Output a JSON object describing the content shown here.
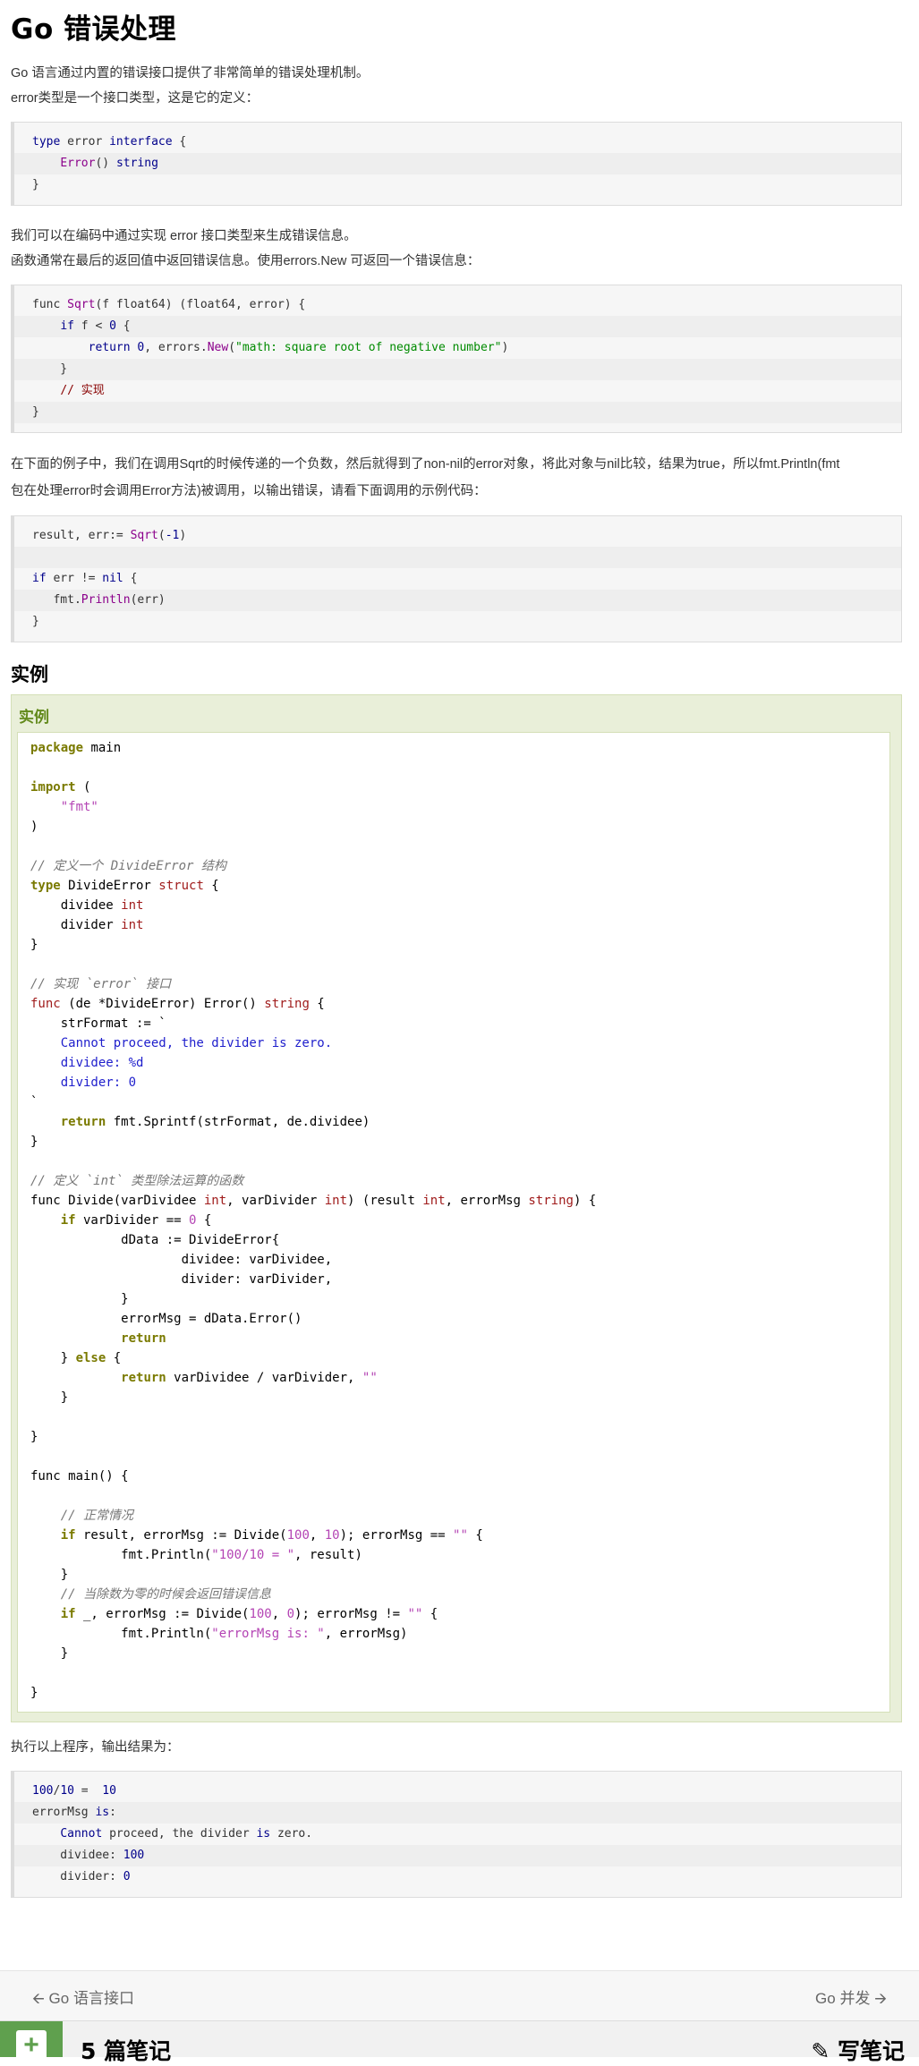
{
  "title": "Go 错误处理",
  "intro": [
    "Go 语言通过内置的错误接口提供了非常简单的错误处理机制。",
    "error类型是一个接口类型，这是它的定义："
  ],
  "code1": [
    "type error interface {",
    "    Error() string",
    "}"
  ],
  "para2": [
    "我们可以在编码中通过实现 error 接口类型来生成错误信息。",
    "函数通常在最后的返回值中返回错误信息。使用errors.New 可返回一个错误信息："
  ],
  "code2": [
    "func Sqrt(f float64) (float64, error) {",
    "    if f < 0 {",
    "        return 0, errors.New(\"math: square root of negative number\")",
    "    }",
    "    // 实现",
    "}"
  ],
  "para3": [
    "在下面的例子中，我们在调用Sqrt的时候传递的一个负数，然后就得到了non-nil的error对象，将此对象与nil比较，结果为true，所以fmt.Println(fmt",
    "包在处理error时会调用Error方法)被调用，以输出错误，请看下面调用的示例代码："
  ],
  "code3": [
    "result, err:= Sqrt(-1)",
    "",
    "if err != nil {",
    "   fmt.Println(err)",
    "}"
  ],
  "section_heading": "实例",
  "example_label": "实例",
  "para4": "执行以上程序，输出结果为：",
  "output": [
    "100/10 =  10",
    "errorMsg is:",
    "    Cannot proceed, the divider is zero.",
    "    dividee: 100",
    "    divider: 0"
  ],
  "nav": {
    "prev": "Go 语言接口",
    "next": "Go 并发"
  },
  "notes": {
    "count": "5 篇笔记",
    "write": "写笔记"
  }
}
